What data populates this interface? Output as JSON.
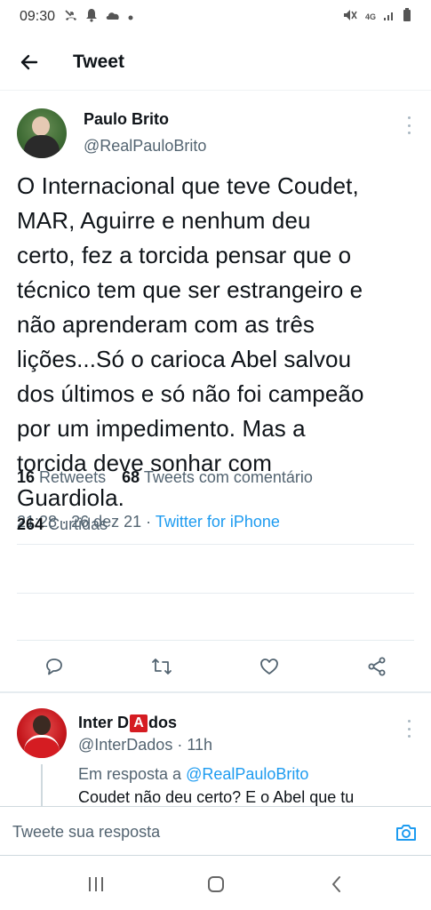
{
  "status_bar": {
    "time": "09:30",
    "network": "4G"
  },
  "header": {
    "title": "Tweet",
    "back_icon": "arrow-left-icon"
  },
  "tweet": {
    "author_name": "Paulo Brito",
    "author_handle": "@RealPauloBrito",
    "text_lines": [
      "O Internacional que teve Coudet,",
      "MAR, Aguirre e nenhum deu",
      "certo, fez a torcida pensar que o",
      "técnico tem que ser estrangeiro e",
      "não aprenderam com as três",
      "lições...Só o carioca Abel salvou",
      "dos últimos e só não foi campeão",
      "por um impedimento. Mas a",
      "torcida deve sonhar com",
      "Guardiola."
    ],
    "time": "21:28",
    "date": "26 dez 21",
    "separator": "·",
    "source": "Twitter for iPhone",
    "retweets_count": "16",
    "retweets_label": "Retweets",
    "quotes_count": "68",
    "quotes_label": "Tweets com comentário",
    "likes_count": "264",
    "likes_label": "Curtidas"
  },
  "reply": {
    "name_before": "Inter D",
    "name_highlight": "A",
    "name_after": "dos",
    "handle": "@InterDados",
    "separator": "·",
    "time": "11h",
    "reply_to_label": "Em resposta a",
    "reply_to_mention": "@RealPauloBrito",
    "text": "Coudet não deu certo? E o Abel que tu"
  },
  "compose": {
    "placeholder": "Tweete sua resposta"
  },
  "colors": {
    "accent": "#1d9bf0",
    "text_primary": "#0f1419",
    "text_secondary": "#536471",
    "divider": "#e6ecf0",
    "inter_red": "#d51c22"
  }
}
